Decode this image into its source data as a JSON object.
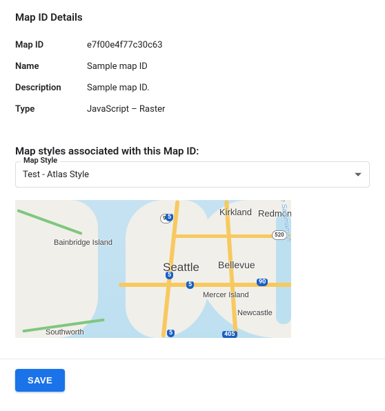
{
  "header": {
    "title": "Map ID Details"
  },
  "details": {
    "rowMapId": {
      "label": "Map ID",
      "value": "e7f00e4f77c30c63"
    },
    "rowName": {
      "label": "Name",
      "value": "Sample map ID"
    },
    "rowDesc": {
      "label": "Description",
      "value": "Sample map ID."
    },
    "rowType": {
      "label": "Type",
      "value": "JavaScript – Raster"
    }
  },
  "styles": {
    "heading": "Map styles associated with this Map ID:",
    "selectLabel": "Map Style",
    "selectedValue": "Test - Atlas Style"
  },
  "map": {
    "labels": {
      "seattle": "Seattle",
      "bellevue": "Bellevue",
      "kirkland": "Kirkland",
      "redmond": "Redmond",
      "mercer": "Mercer Island",
      "newcastle": "Newcastle",
      "bainbridge": "Bainbridge\nIsland",
      "southworth": "Southworth",
      "sammamish": "Lake Sammamish"
    },
    "shields": {
      "i5a": "5",
      "i5b": "5",
      "i5c": "5",
      "i5d": "5",
      "i90": "90",
      "i405": "405",
      "sr99": "99",
      "sr520": "520"
    }
  },
  "footer": {
    "saveLabel": "SAVE"
  }
}
